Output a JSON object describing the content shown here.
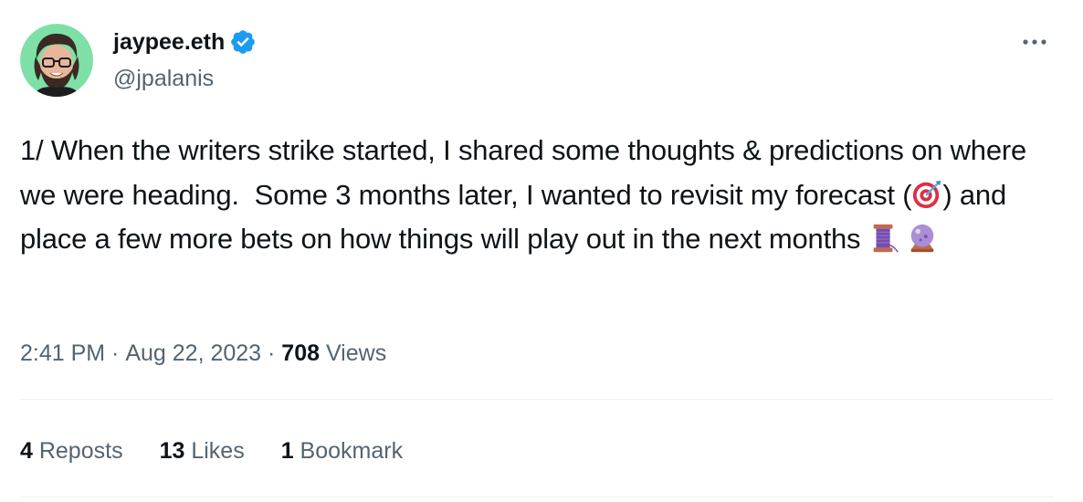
{
  "author": {
    "display_name": "jaypee.eth",
    "handle": "@jpalanis",
    "verified": true,
    "verified_color": "#1d9bf0",
    "avatar_background": "#7ee0a6"
  },
  "tweet": {
    "text_parts": {
      "p1": "1/ When the writers strike started, I shared some thoughts & predictions on where we were heading.  Some 3 months later, I wanted to revisit my forecast (",
      "p2": ") and place a few more bets on how things will play out in the next months "
    },
    "emojis": [
      "direct-hit-icon",
      "spool-of-thread-icon",
      "crystal-ball-icon"
    ]
  },
  "meta": {
    "time": "2:41 PM",
    "separator": " · ",
    "date": "Aug 22, 2023",
    "views_count": "708",
    "views_label": " Views"
  },
  "stats": {
    "reposts_count": "4",
    "reposts_label": " Reposts",
    "likes_count": "13",
    "likes_label": " Likes",
    "bookmarks_count": "1",
    "bookmarks_label": " Bookmark"
  },
  "colors": {
    "text_primary": "#0f1419",
    "text_secondary": "#536471",
    "divider": "#eff3f4"
  }
}
